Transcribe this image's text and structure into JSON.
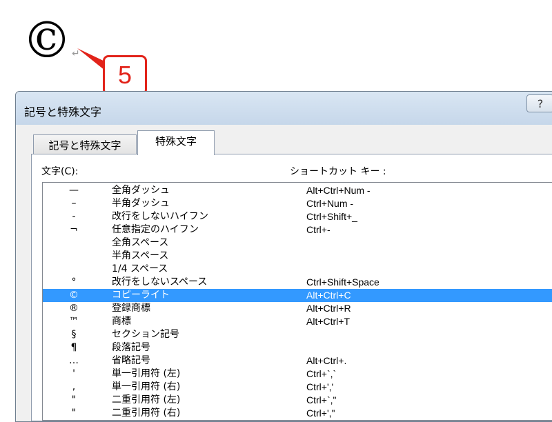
{
  "document": {
    "symbol": "©",
    "paragraph_mark": "↵"
  },
  "callout": {
    "number": "5",
    "color": "#e2231a"
  },
  "dialog": {
    "title": "記号と特殊文字",
    "help_label": "?",
    "tabs": [
      {
        "label": "記号と特殊文字",
        "active": false
      },
      {
        "label": "特殊文字",
        "active": true
      }
    ],
    "columns": {
      "character": "文字(C):",
      "shortcut": "ショートカット キー :"
    },
    "rows": [
      {
        "symbol": "—",
        "name": "全角ダッシュ",
        "shortcut": "Alt+Ctrl+Num -"
      },
      {
        "symbol": "–",
        "name": "半角ダッシュ",
        "shortcut": "Ctrl+Num -"
      },
      {
        "symbol": "-",
        "name": "改行をしないハイフン",
        "shortcut": "Ctrl+Shift+_"
      },
      {
        "symbol": "¬",
        "name": "任意指定のハイフン",
        "shortcut": "Ctrl+-"
      },
      {
        "symbol": "",
        "name": "全角スペース",
        "shortcut": ""
      },
      {
        "symbol": "",
        "name": "半角スペース",
        "shortcut": ""
      },
      {
        "symbol": "",
        "name": "1/4 スペース",
        "shortcut": ""
      },
      {
        "symbol": "°",
        "name": "改行をしないスペース",
        "shortcut": "Ctrl+Shift+Space"
      },
      {
        "symbol": "©",
        "name": "コピーライト",
        "shortcut": "Alt+Ctrl+C",
        "selected": true
      },
      {
        "symbol": "®",
        "name": "登録商標",
        "shortcut": "Alt+Ctrl+R"
      },
      {
        "symbol": "™",
        "name": "商標",
        "shortcut": "Alt+Ctrl+T"
      },
      {
        "symbol": "§",
        "name": "セクション記号",
        "shortcut": ""
      },
      {
        "symbol": "¶",
        "name": "段落記号",
        "shortcut": ""
      },
      {
        "symbol": "…",
        "name": "省略記号",
        "shortcut": "Alt+Ctrl+."
      },
      {
        "symbol": "'",
        "name": "単一引用符 (左)",
        "shortcut": "Ctrl+`,`"
      },
      {
        "symbol": ",",
        "name": "単一引用符 (右)",
        "shortcut": "Ctrl+','"
      },
      {
        "symbol": "\"",
        "name": "二重引用符 (左)",
        "shortcut": "Ctrl+`,\""
      },
      {
        "symbol": "\"",
        "name": "二重引用符 (右)",
        "shortcut": "Ctrl+',\""
      }
    ],
    "selection_color": "#3399ff"
  }
}
